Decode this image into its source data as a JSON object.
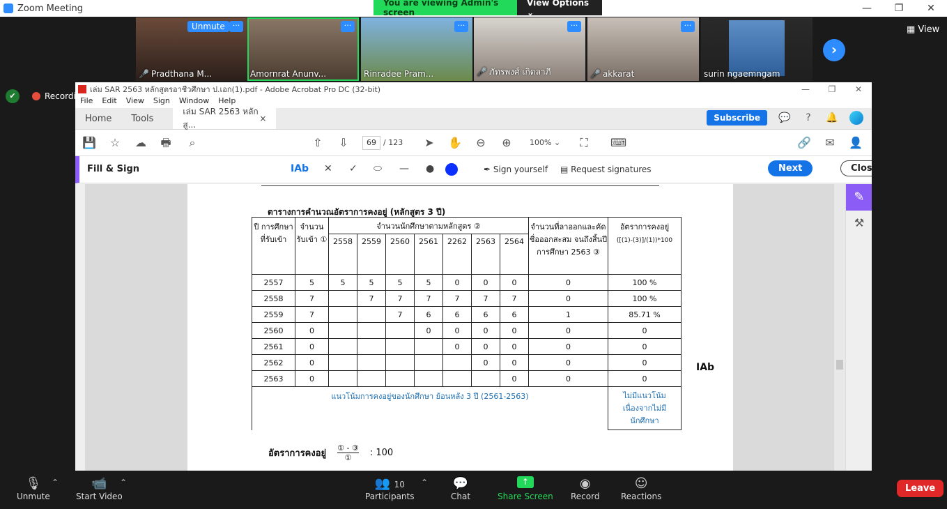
{
  "zoom": {
    "title": "Zoom Meeting",
    "banner_text": "You are viewing Admin's screen",
    "view_options": "View Options ⌄",
    "view_label": "View",
    "recording_label": "Recordin",
    "participants": [
      {
        "name": "Pradthana M...",
        "muted": true,
        "unmute_chip": "Unmute"
      },
      {
        "name": "Amornrat Anunv...",
        "muted": false,
        "active": true
      },
      {
        "name": "Rinradee Pram...",
        "muted": false
      },
      {
        "name": "ภัทรพงศ์ เกิดลาภี",
        "muted": true
      },
      {
        "name": "akkarat",
        "muted": true
      },
      {
        "name": "surin ngaemngam",
        "muted": false
      }
    ],
    "more": "···"
  },
  "acrobat": {
    "title": "เล่ม SAR 2563 หลักสูตรอาชีวศึกษา ป.เอก(1).pdf - Adobe Acrobat Pro DC (32-bit)",
    "menu": [
      "File",
      "Edit",
      "View",
      "Sign",
      "Window",
      "Help"
    ],
    "tabs": {
      "home": "Home",
      "tools": "Tools",
      "doc": "เล่ม SAR 2563 หลักสู...",
      "close": "×"
    },
    "subscribe": "Subscribe",
    "page_current": "69",
    "page_total": "/  123",
    "zoom": "100%",
    "fill_sign": "Fill & Sign",
    "text_tool": "Ab",
    "sign_yourself": "Sign yourself",
    "request_signatures": "Request signatures",
    "next": "Next",
    "close": "Close"
  },
  "document": {
    "caption": "ตารางการคำนวณอัตราการคงอยู่ (หลักสูตร 3 ปี)",
    "header": {
      "year": "ปี การศึกษา ที่รับเข้า",
      "intake": "จำนวน รับเข้า ①",
      "students": "จำนวนนักศึกษาตามหลักสูตร ②",
      "years": [
        "2558",
        "2559",
        "2560",
        "2561",
        "2262",
        "2563",
        "2564"
      ],
      "dropout": "จำนวนที่ลาออกและคัดชื่อออกสะสม จนถึงสิ้นปีการศึกษา 2563 ③",
      "rate": "อัตราการคงอยู่",
      "rate_formula": "([(1)-(3)]/(1))*100"
    },
    "rows": [
      {
        "year": "2557",
        "intake": "5",
        "cells": [
          "5",
          "5",
          "5",
          "5",
          "0",
          "0",
          "0"
        ],
        "dropout": "0",
        "rate": "100 %"
      },
      {
        "year": "2558",
        "intake": "7",
        "cells": [
          "",
          "7",
          "7",
          "7",
          "7",
          "7",
          "7"
        ],
        "dropout": "0",
        "rate": "100 %"
      },
      {
        "year": "2559",
        "intake": "7",
        "cells": [
          "",
          "",
          "7",
          "6",
          "6",
          "6",
          "6"
        ],
        "dropout": "1",
        "rate": "85.71 %"
      },
      {
        "year": "2560",
        "intake": "0",
        "cells": [
          "",
          "",
          "",
          "0",
          "0",
          "0",
          "0"
        ],
        "dropout": "0",
        "rate": "0"
      },
      {
        "year": "2561",
        "intake": "0",
        "cells": [
          "",
          "",
          "",
          "",
          "0",
          "0",
          "0"
        ],
        "dropout": "0",
        "rate": "0"
      },
      {
        "year": "2562",
        "intake": "0",
        "cells": [
          "",
          "",
          "",
          "",
          "",
          "0",
          "0"
        ],
        "dropout": "0",
        "rate": "0"
      },
      {
        "year": "2563",
        "intake": "0",
        "cells": [
          "",
          "",
          "",
          "",
          "",
          "",
          "0"
        ],
        "dropout": "0",
        "rate": "0"
      }
    ],
    "trend_label": "แนวโน้มการคงอยู่ของนักศึกษา ย้อนหลัง 3 ปี (2561-2563)",
    "trend_value": "ไม่มีแนวโน้ม เนื่องจากไม่มี นักศึกษา",
    "formula_label": "อัตราการคงอยู่",
    "formula_top": "① - ③",
    "formula_bottom": "①",
    "formula_mult": ":  100",
    "cursor_text": "Ab"
  },
  "toolbar": {
    "unmute": "Unmute",
    "start_video": "Start Video",
    "participants": "Participants",
    "participants_count": "10",
    "chat": "Chat",
    "share_screen": "Share Screen",
    "record": "Record",
    "reactions": "Reactions",
    "leave": "Leave"
  },
  "colors": {
    "zoom_blue": "#2d8cff",
    "share_green": "#23d959",
    "leave_red": "#e02828",
    "acrobat_blue": "#1473e6",
    "fill_sign_purple": "#8b5cf6"
  }
}
